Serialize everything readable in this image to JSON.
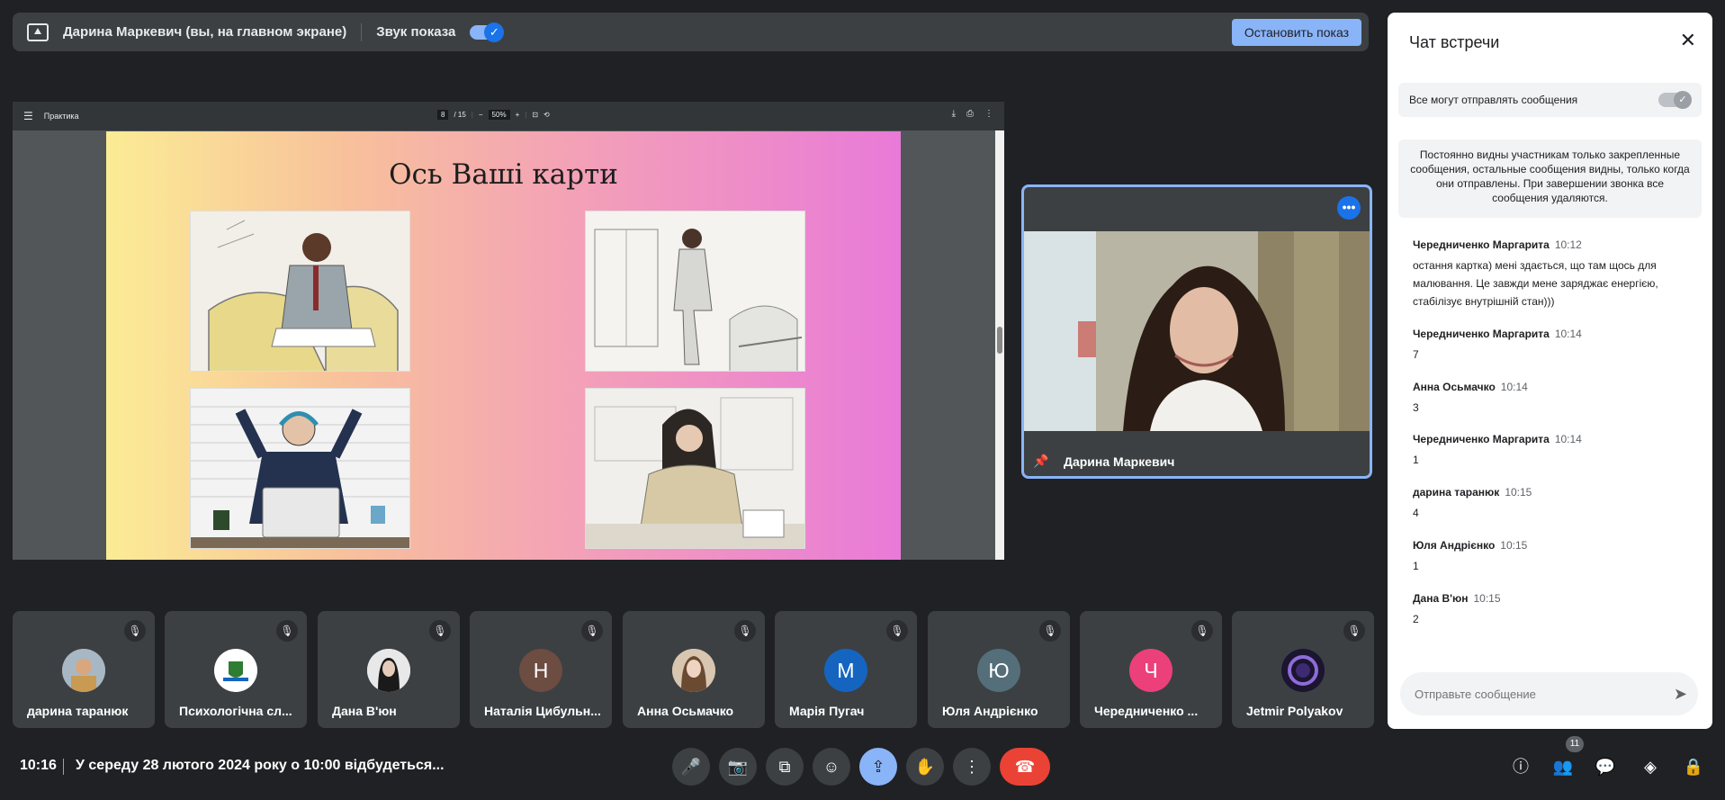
{
  "presenting": {
    "name": "Дарина Маркевич (вы, на главном экране)",
    "sound_label": "Звук показа",
    "stop_button": "Остановить показ"
  },
  "pdf": {
    "doc_title": "Практика",
    "page_current": "8",
    "page_total": "/ 15",
    "zoom": "50%",
    "slide_title": "Ось Ваші карти"
  },
  "presenter": {
    "name": "Дарина Маркевич"
  },
  "participants": [
    {
      "name": "дарина таранюк",
      "initial": "",
      "color": "#9c8f6a"
    },
    {
      "name": "Психологічна сл...",
      "initial": "",
      "color": "#f5f5f5"
    },
    {
      "name": "Дана В'юн",
      "initial": "",
      "color": "#dedede"
    },
    {
      "name": "Наталія Цибульн...",
      "initial": "Н",
      "color": "#6d4c41"
    },
    {
      "name": "Анна Осьмачко",
      "initial": "",
      "color": "#c7a98a"
    },
    {
      "name": "Марія Пугач",
      "initial": "М",
      "color": "#1565c0"
    },
    {
      "name": "Юля Андрієнко",
      "initial": "Ю",
      "color": "#546e7a"
    },
    {
      "name": "Чередниченко ...",
      "initial": "Ч",
      "color": "#ec407a"
    },
    {
      "name": "Jetmir Polyakov",
      "initial": "",
      "color": "#2a1f4a"
    }
  ],
  "bottom": {
    "clock": "10:16",
    "meeting_title": "У середу 28 лютого 2024 року о 10:00 відбудеться...",
    "people_count": "11"
  },
  "chat": {
    "title": "Чат встречи",
    "setting_label": "Все могут отправлять сообщения",
    "info": "Постоянно видны участникам только закрепленные сообщения, остальные сообщения видны, только когда они отправлены. При завершении звонка все сообщения удаляются.",
    "messages": [
      {
        "author": "Чередниченко Маргарита",
        "time": "10:12",
        "text": "остання картка) мені здається, що там щось для малювання. Це завжди мене заряджає енергією, стабілізує внутрішній стан)))"
      },
      {
        "author": "Чередниченко Маргарита",
        "time": "10:14",
        "text": "7"
      },
      {
        "author": "Анна Осьмачко",
        "time": "10:14",
        "text": "3"
      },
      {
        "author": "Чередниченко Маргарита",
        "time": "10:14",
        "text": "1"
      },
      {
        "author": "дарина таранюк",
        "time": "10:15",
        "text": "4"
      },
      {
        "author": "Юля Андрієнко",
        "time": "10:15",
        "text": "1"
      },
      {
        "author": "Дана В'юн",
        "time": "10:15",
        "text": "2"
      }
    ],
    "input_placeholder": "Отправьте сообщение"
  },
  "colors": {
    "accent": "#8ab4f8",
    "blue": "#1a73e8",
    "hangup": "#ea4335",
    "background": "#202124"
  }
}
